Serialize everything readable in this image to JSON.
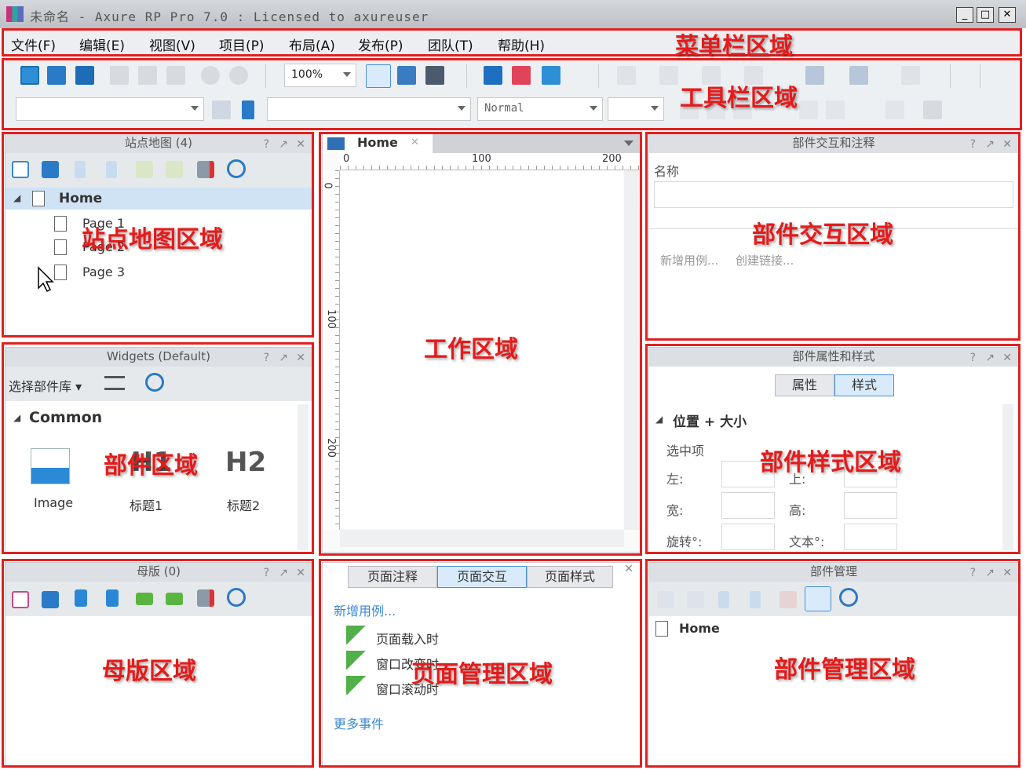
{
  "window": {
    "title": "未命名 - Axure RP Pro 7.0 : Licensed to axureuser",
    "buttons": {
      "minimize": "_",
      "maximize": "□",
      "close": "✕"
    }
  },
  "menu": {
    "items": [
      "文件(F)",
      "编辑(E)",
      "视图(V)",
      "项目(P)",
      "布局(A)",
      "发布(P)",
      "团队(T)",
      "帮助(H)"
    ]
  },
  "toolbar": {
    "zoom": "100%",
    "font_combo": "",
    "style_combo": "Normal",
    "size_combo": ""
  },
  "sitemap": {
    "title": "站点地图 (4)",
    "help": "?",
    "float": "↗",
    "close": "✕",
    "home": "Home",
    "pages": [
      "Page 1",
      "Page 2",
      "Page 3"
    ]
  },
  "widgets": {
    "title": "Widgets (Default)",
    "help": "?",
    "float": "↗",
    "close": "✕",
    "library_select": "选择部件库",
    "section": "Common",
    "items": [
      {
        "label": "Image"
      },
      {
        "label": "标题1",
        "glyph": "H1"
      },
      {
        "label": "标题2",
        "glyph": "H2"
      }
    ]
  },
  "masters": {
    "title": "母版 (0)",
    "help": "?",
    "float": "↗",
    "close": "✕"
  },
  "canvas": {
    "tab": "Home",
    "tab_close": "✕",
    "ruler_h": [
      "0",
      "100",
      "200"
    ],
    "ruler_v": [
      "0",
      "100",
      "200"
    ]
  },
  "page_panel": {
    "tabs": [
      "页面注释",
      "页面交互",
      "页面样式"
    ],
    "active_tab": 1,
    "float": "↗",
    "close": "✕",
    "add_case": "新增用例...",
    "events": [
      "页面载入时",
      "窗口改变时",
      "窗口滚动时"
    ],
    "more_events": "更多事件"
  },
  "interactions": {
    "title": "部件交互和注释",
    "help": "?",
    "float": "↗",
    "close": "✕",
    "name_label": "名称",
    "link1": "新增用例...",
    "link2": "创建链接..."
  },
  "properties": {
    "title": "部件属性和样式",
    "help": "?",
    "float": "↗",
    "close": "✕",
    "tabs": [
      "属性",
      "样式"
    ],
    "active_tab": 1,
    "section": "位置 + 大小",
    "selected_label": "选中项",
    "fields": {
      "left": "左:",
      "top": "上:",
      "width": "宽:",
      "height": "高:",
      "rotate": "旋转°:",
      "text": "文本°:"
    }
  },
  "outline": {
    "title": "部件管理",
    "help": "?",
    "float": "↗",
    "close": "✕",
    "items": [
      "Home"
    ]
  },
  "annotations": {
    "menu": "菜单栏区域",
    "toolbar": "工具栏区域",
    "sitemap": "站点地图区域",
    "widgets": "部件区域",
    "masters": "母版区域",
    "work": "工作区域",
    "page": "页面管理区域",
    "interaction": "部件交互区域",
    "style": "部件样式区域",
    "outline": "部件管理区域"
  },
  "colors": {
    "annotation_red": "#e02020",
    "accent_blue": "#2f7fd1",
    "panel_header": "#dcdfe3"
  }
}
